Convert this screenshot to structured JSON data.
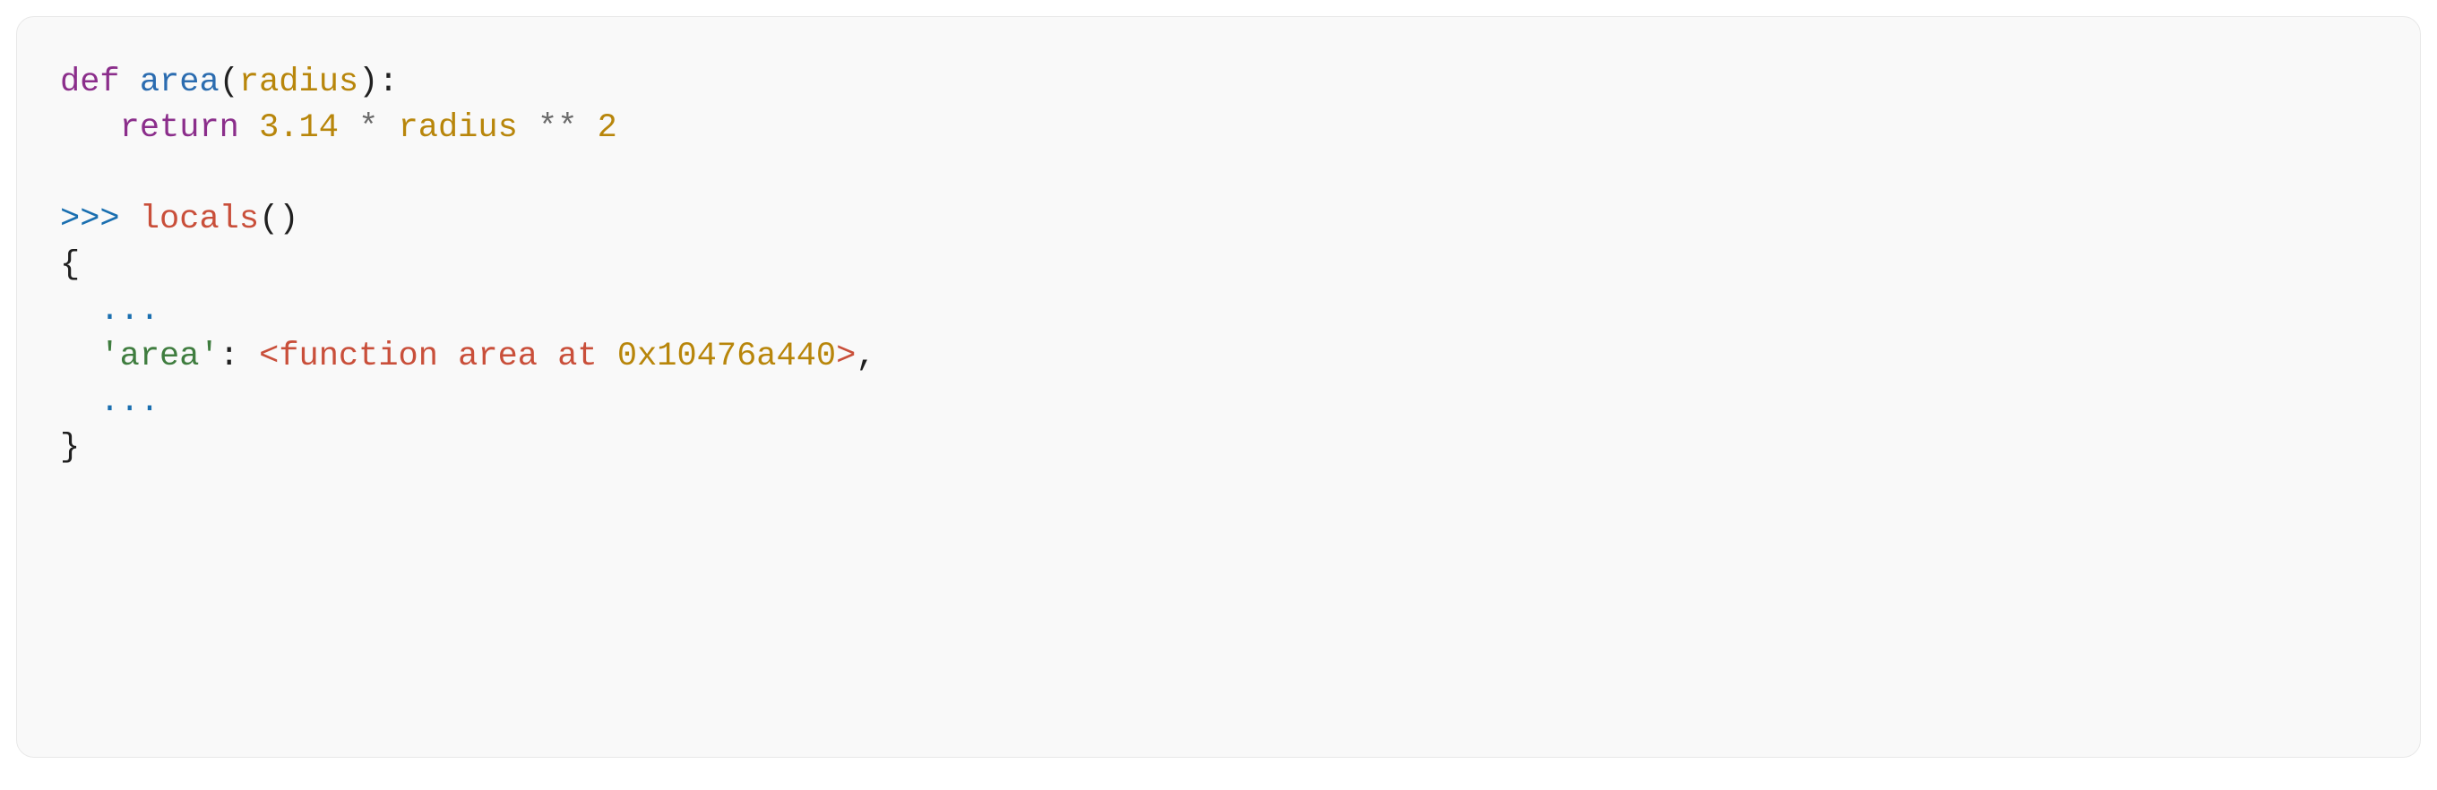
{
  "code": {
    "line1": {
      "kw_def": "def",
      "sp1": " ",
      "fn_name": "area",
      "paren_open": "(",
      "param": "radius",
      "paren_close": ")",
      "colon": ":"
    },
    "line2": {
      "indent": "   ",
      "kw_return": "return",
      "sp1": " ",
      "num_pi": "3.14",
      "sp2": " ",
      "op_mul": "*",
      "sp3": " ",
      "var_radius": "radius",
      "sp4": " ",
      "op_pow": "**",
      "sp5": " ",
      "num_exp": "2"
    },
    "line3": "",
    "line4": {
      "prompt": ">>>",
      "sp1": " ",
      "call": "locals",
      "paren_open": "(",
      "paren_close": ")"
    },
    "line5": {
      "brace_open": "{"
    },
    "line6": {
      "indent": "  ",
      "ellipsis": "..."
    },
    "line7": {
      "indent": "  ",
      "key": "'area'",
      "colon": ":",
      "sp1": " ",
      "lt": "<",
      "cls": "function",
      "sp2": " ",
      "name": "area",
      "sp3": " ",
      "at": "at",
      "sp4": " ",
      "addr": "0x10476a440",
      "gt": ">",
      "comma": ","
    },
    "line8": {
      "indent": "  ",
      "ellipsis": "..."
    },
    "line9": {
      "brace_close": "}"
    }
  }
}
